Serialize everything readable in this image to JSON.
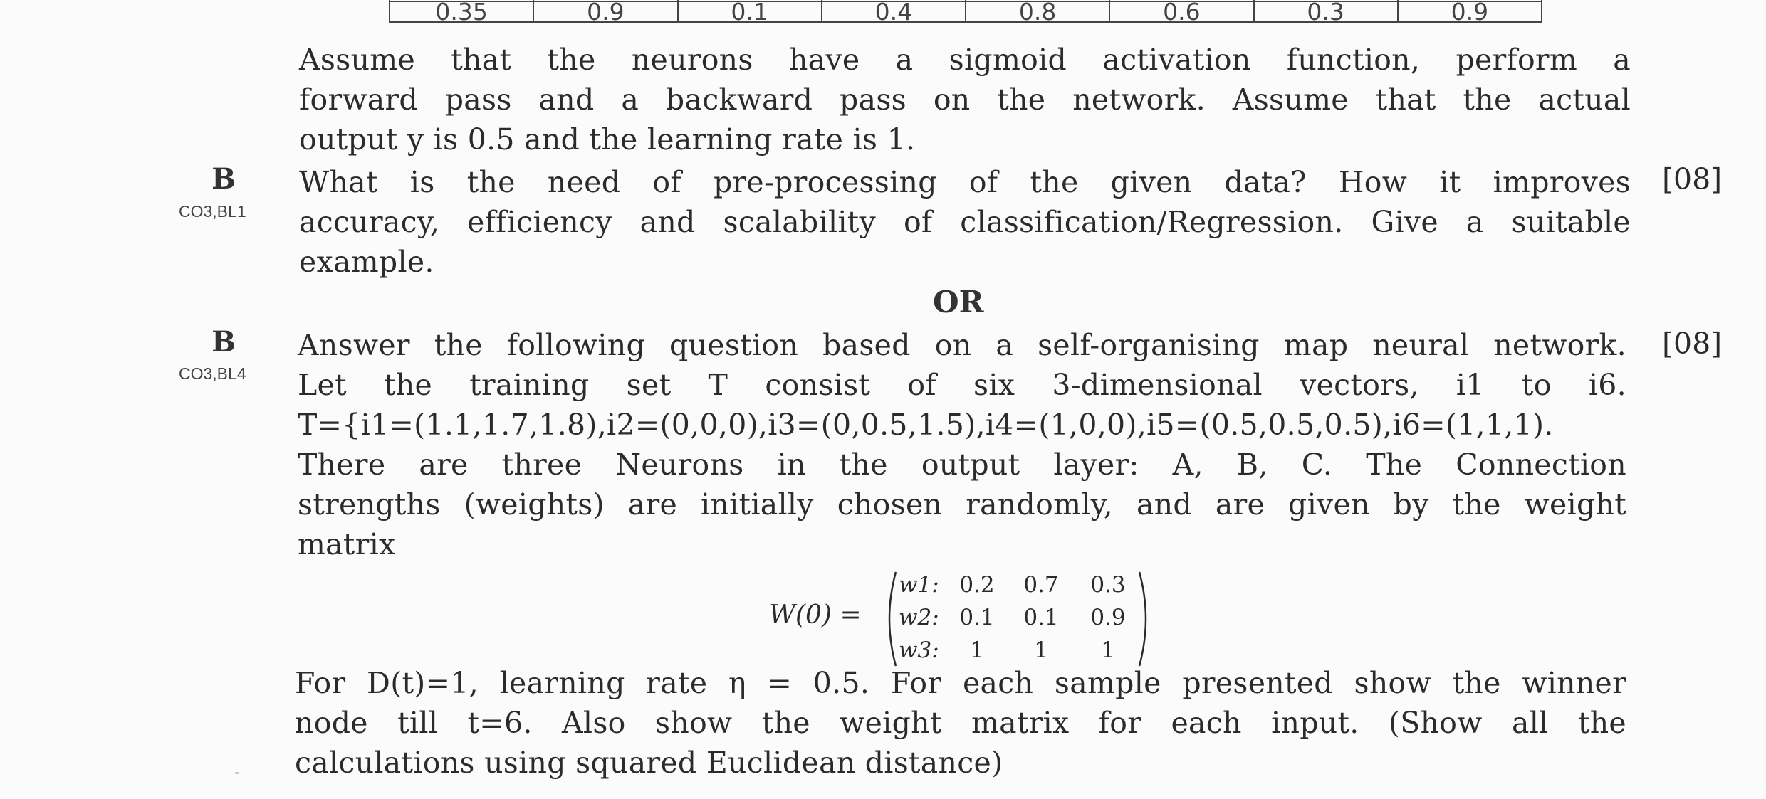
{
  "table": {
    "header_row": [
      "",
      "",
      "",
      "",
      "",
      "",
      "",
      ""
    ],
    "values": [
      "0.35",
      "0.9",
      "0.1",
      "0.4",
      "0.8",
      "0.6",
      "0.3",
      "0.9"
    ]
  },
  "paragraph_a": {
    "lines": [
      "Assume that the neurons have a sigmoid activation function, perform a",
      "forward pass and a backward pass on the network. Assume that the actual",
      "output y is 0.5 and the learning rate is 1."
    ]
  },
  "question_b1": {
    "letter": "B",
    "code": "CO3,BL1",
    "marks": "[08]",
    "lines": [
      "What is the need of pre-processing of the given data? How it improves",
      "accuracy, efficiency and scalability of classification/Regression. Give a suitable",
      "example."
    ]
  },
  "or_label": "OR",
  "question_b2": {
    "letter": "B",
    "code": "CO3,BL4",
    "marks": "[08]",
    "lines": [
      "Answer the following question based on a self-organising map neural network.",
      "Let the training set T consist of six 3-dimensional vectors, i1 to i6.",
      "T={i1=(1.1,1.7,1.8),i2=(0,0,0),i3=(0,0.5,1.5),i4=(1,0,0),i5=(0.5,0.5,0.5),i6=(1,1,1).",
      "There are three Neurons in the output layer: A, B, C. The Connection",
      "strengths (weights) are initially chosen randomly, and are given by the weight",
      "matrix"
    ],
    "matrix": {
      "label": "W(0) =",
      "rows": [
        {
          "name": "w1:",
          "values": [
            "0.2",
            "0.7",
            "0.3"
          ]
        },
        {
          "name": "w2:",
          "values": [
            "0.1",
            "0.1",
            "0.9"
          ]
        },
        {
          "name": "w3:",
          "values": [
            "1",
            "1",
            "1"
          ]
        }
      ]
    },
    "after_lines": [
      "For D(t)=1, learning rate η = 0.5. For each sample presented show the winner",
      "node till t=6. Also show the weight matrix for each input. (Show all the",
      "calculations using squared Euclidean distance)"
    ]
  }
}
